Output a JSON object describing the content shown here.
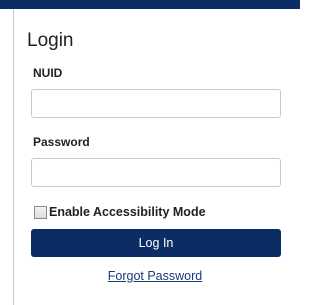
{
  "login": {
    "title": "Login",
    "nuid_label": "NUID",
    "nuid_value": "",
    "password_label": "Password",
    "password_value": "",
    "accessibility_label": "Enable Accessibility Mode",
    "submit_label": "Log In",
    "forgot_label": "Forgot Password"
  },
  "colors": {
    "accent": "#0c2d63",
    "link": "#1a3a7a"
  }
}
